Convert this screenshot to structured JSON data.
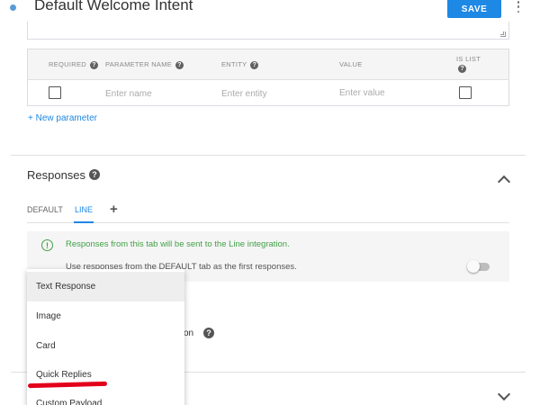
{
  "header": {
    "title": "Default Welcome Intent",
    "save_label": "SAVE"
  },
  "parameters": {
    "headers": {
      "required": "REQUIRED",
      "parameter_name": "PARAMETER NAME",
      "entity": "ENTITY",
      "value": "VALUE",
      "is_list": "IS LIST"
    },
    "row": {
      "name_placeholder": "Enter name",
      "entity_placeholder": "Enter entity",
      "value_placeholder": "Enter value"
    },
    "new_parameter_label": "+ New parameter"
  },
  "responses": {
    "title": "Responses",
    "tabs": [
      "DEFAULT",
      "LINE"
    ],
    "active_tab": "LINE",
    "add_tab_label": "+",
    "info_text": "Responses from this tab will be sent to the Line integration.",
    "use_default_text": "Use responses from the DEFAULT tab as the first responses.",
    "use_default_enabled": false
  },
  "behind_menu_text": "on",
  "add_response_menu": {
    "items": [
      "Text Response",
      "Image",
      "Card",
      "Quick Replies",
      "Custom Payload"
    ],
    "highlighted": "Text Response",
    "annotated": "Quick Replies"
  },
  "colors": {
    "accent": "#1e88e5",
    "success": "#43a047",
    "annotation": "#e3001b"
  }
}
